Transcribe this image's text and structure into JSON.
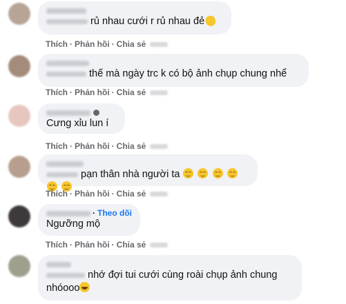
{
  "actions": {
    "like": "Thích",
    "reply": "Phản hồi",
    "share": "Chia sẻ",
    "separator": "·"
  },
  "comments": [
    {
      "text": "rủ nhau cưới r rủ nhau đẻ",
      "emoji": "clapping-hands-icon"
    },
    {
      "text": "thế mà ngày trc k có bộ ảnh chụp chung nhể"
    },
    {
      "text": "Cưng xỉu lun í"
    },
    {
      "text": "pạn thân nhà người ta",
      "emoji_count": 6,
      "emoji": "relieved-face-icon"
    },
    {
      "follow_label": "Theo dõi",
      "text": "Ngưỡng mộ"
    },
    {
      "text_line1": "nhớ đợi tui cưới cùng roài chụp ảnh chung",
      "text_line2": "nhóooo",
      "emoji": "grinning-face-icon"
    }
  ]
}
